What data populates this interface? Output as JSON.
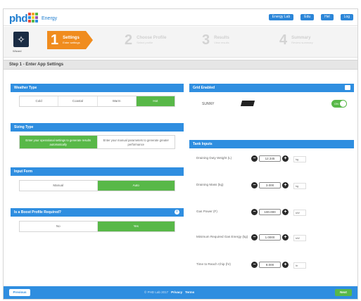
{
  "header": {
    "logo_text": "phd",
    "logo_sub": "Energy",
    "logo_colors": [
      "#e84a3c",
      "#f2a62a",
      "#58b848",
      "#2f8ee0",
      "#f2d22a",
      "#9b59b6",
      "#e84a3c",
      "#58b848",
      "#2f8ee0"
    ],
    "top_links": [
      "Energy Lab",
      "Edu",
      "Hel",
      "Log"
    ]
  },
  "steps": {
    "wand_label": "Wizard",
    "items": [
      {
        "num": "1",
        "title": "Settings",
        "sub": "Enter settings",
        "active": true
      },
      {
        "num": "2",
        "title": "Choose Profile",
        "sub": "Select profile",
        "active": false
      },
      {
        "num": "3",
        "title": "Results",
        "sub": "View results",
        "active": false
      },
      {
        "num": "4",
        "title": "Summary",
        "sub": "Review summary",
        "active": false
      }
    ]
  },
  "section_title": "Step 1 - Enter App Settings",
  "left": {
    "weather": {
      "title": "Weather Type",
      "options": [
        "Cold",
        "Coastal",
        "Warm",
        "Hot"
      ],
      "selected": 3
    },
    "sizing": {
      "title": "Sizing Type",
      "options": [
        "Enter your operational settings to generate results automatically",
        "Enter your manual parameters to generate greater performance"
      ],
      "selected": 0
    },
    "input": {
      "title": "Input Form",
      "options": [
        "Manual",
        "Auto"
      ],
      "selected": 1
    },
    "boost": {
      "title": "Is a Boost Profile Required?",
      "options": [
        "No",
        "Yes"
      ],
      "selected": 1
    }
  },
  "right": {
    "grid": {
      "title": "Grid Enabled",
      "system_name": "SUNNY",
      "toggle_text": "ON"
    },
    "tank": {
      "title": "Tank Inputs",
      "rows": [
        {
          "label": "Draining Duty Weight (L)",
          "value": "12.345",
          "unit": "kg"
        },
        {
          "label": "Draining Mass (kg)",
          "value": "3.000",
          "unit": "kg"
        },
        {
          "label": "Gas Power (F)",
          "value": "100.000",
          "unit": "kW"
        },
        {
          "label": "Minimum Required Gas Energy (kg)",
          "value": "1.0000",
          "unit": "kW"
        },
        {
          "label": "Time to Reach Chip (hr)",
          "value": "8.000",
          "unit": "hr"
        }
      ]
    }
  },
  "footer": {
    "previous": "Previous",
    "copyright": "© PHD Lab 2017",
    "privacy": "Privacy",
    "terms": "Terms",
    "next": "Next"
  }
}
